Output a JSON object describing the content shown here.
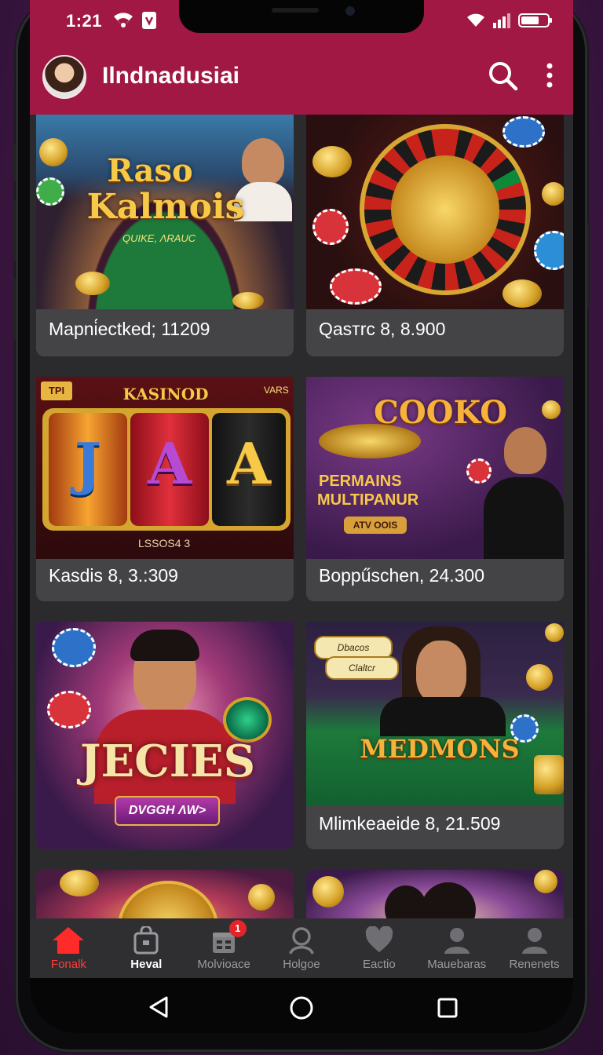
{
  "status_bar": {
    "time": "1:21"
  },
  "app_bar": {
    "title": "Ilndnadusiai"
  },
  "games": [
    {
      "caption": "Mapnі́ectked; 11209",
      "art_title_1": "Raso",
      "art_title_2": "Kalmois",
      "art_sub": "QUIKE, ΛRAUC"
    },
    {
      "caption": "Qasтrc 8, 8.900"
    },
    {
      "caption": "Kasdis 8, 3.:309",
      "art_banner": "KASINOD",
      "art_corner_left": "TPI",
      "art_corner_right": "VARS",
      "reel_1": "J",
      "reel_2": "A",
      "reel_3": "A",
      "art_bottom": "LSSOS4 3"
    },
    {
      "caption": "Boppűschen, 24.300",
      "art_title": "COOKO",
      "art_sub_1": "PERMAINS",
      "art_sub_2": "MULTIPANUR",
      "art_button": "ATV OOIS"
    },
    {
      "caption": "",
      "art_title": "JECIES",
      "art_ribbon": "DVGGH ΛW>"
    },
    {
      "caption": "Mlimkeaeide 8, 21.509",
      "art_title": "MEDMONS",
      "art_sign_1": "Dbacos",
      "art_sign_2": "Claltcr"
    },
    {
      "caption": ""
    },
    {
      "caption": ""
    }
  ],
  "bottom_nav": [
    {
      "label": "Fonalk",
      "icon": "home-icon",
      "state": "active"
    },
    {
      "label": "Heval",
      "icon": "bag-icon",
      "state": "bold"
    },
    {
      "label": "Molvioace",
      "icon": "gift-icon",
      "badge": "1"
    },
    {
      "label": "Holgoe",
      "icon": "user-search-icon"
    },
    {
      "label": "Eactio",
      "icon": "heart-icon"
    },
    {
      "label": "Mauebaras",
      "icon": "person-icon"
    },
    {
      "label": "Renenets",
      "icon": "person-icon"
    }
  ],
  "colors": {
    "brand": "#a21845",
    "active": "#ff3b3b",
    "background": "#2b2b2e",
    "card": "#444447"
  }
}
